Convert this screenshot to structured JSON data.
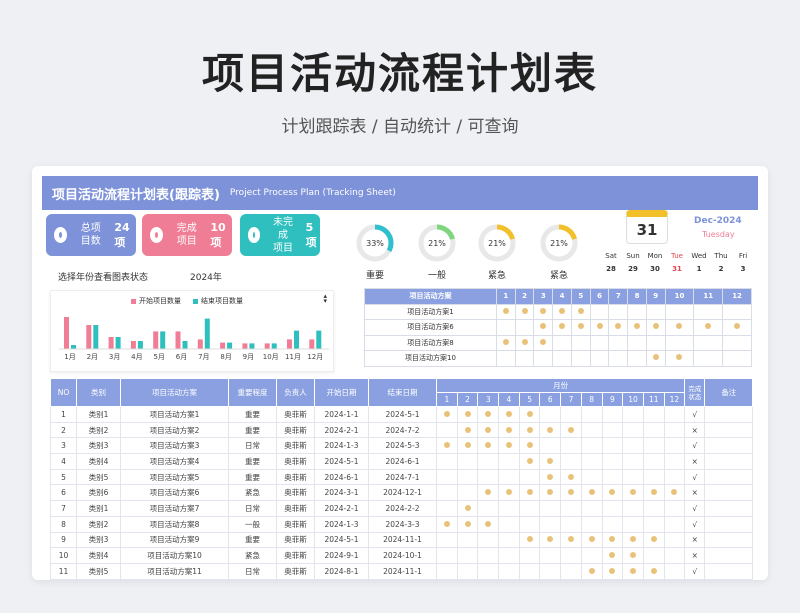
{
  "hero": {
    "title": "项目活动流程计划表",
    "subtitle": "计划跟踪表 / 自动统计 / 可查询"
  },
  "banner": {
    "title": "项目活动流程计划表(跟踪表)",
    "subtitle_en": "Project Process Plan (Tracking Sheet)"
  },
  "cards": [
    {
      "label": "总项\n目数",
      "value": "24项",
      "color": "#7d92d9"
    },
    {
      "label": "完成\n项目",
      "value": "10项",
      "color": "#f07d96"
    },
    {
      "label": "未完成\n项目",
      "value": "5项",
      "color": "#2fbfbf"
    }
  ],
  "select": {
    "label": "选择年份查看图表状态",
    "year": "2024年"
  },
  "donuts": [
    {
      "label": "重要",
      "pct": "33%",
      "value": 0.33,
      "color": "#2fbfcf"
    },
    {
      "label": "一般",
      "pct": "21%",
      "value": 0.21,
      "color": "#7fd67f"
    },
    {
      "label": "紧急",
      "pct": "21%",
      "value": 0.21,
      "color": "#f2c028"
    },
    {
      "label": "紧急",
      "pct": "21%",
      "value": 0.21,
      "color": "#f2c028"
    }
  ],
  "calendar": {
    "day": "31",
    "month": "Dec-2024",
    "weekday": "Tuesday",
    "days": [
      "Sat",
      "Sun",
      "Mon",
      "Tue",
      "Wed",
      "Thu",
      "Fri"
    ],
    "dates": [
      "28",
      "29",
      "30",
      "31",
      "1",
      "2",
      "3"
    ]
  },
  "chart_data": {
    "type": "bar",
    "categories": [
      "1月",
      "2月",
      "3月",
      "4月",
      "5月",
      "6月",
      "7月",
      "8月",
      "9月",
      "10月",
      "11月",
      "12月"
    ],
    "series": [
      {
        "name": "开始项目数量",
        "color": "#f07d96",
        "values": [
          4,
          3,
          1.5,
          1,
          2.2,
          2.2,
          1.2,
          0.8,
          0.7,
          0.7,
          1.2,
          1.2
        ]
      },
      {
        "name": "结束项目数量",
        "color": "#2fbfbf",
        "values": [
          0.5,
          3,
          1.5,
          1,
          2.2,
          1,
          3.8,
          0.8,
          0.7,
          0.7,
          2.3,
          2.3
        ]
      }
    ]
  },
  "mini": {
    "header": "项目活动方案",
    "months": [
      "1",
      "2",
      "3",
      "4",
      "5",
      "6",
      "7",
      "8",
      "9",
      "10",
      "11",
      "12"
    ],
    "rows": [
      {
        "name": "项目活动方案1",
        "m": [
          1,
          2,
          3,
          4,
          5
        ]
      },
      {
        "name": "项目活动方案6",
        "m": [
          3,
          4,
          5,
          6,
          7,
          8,
          9,
          10,
          11,
          12
        ]
      },
      {
        "name": "项目活动方案8",
        "m": [
          1,
          2,
          3
        ]
      },
      {
        "name": "项目活动方案10",
        "m": [
          9,
          10
        ]
      }
    ]
  },
  "table": {
    "headers": {
      "no": "NO",
      "cat": "类别",
      "plan": "项目活动方案",
      "level": "重要程度",
      "owner": "负责人",
      "start": "开始日期",
      "end": "结束日期",
      "months": "月份",
      "status": "完成\n状态",
      "note": "备注"
    },
    "months": [
      "1",
      "2",
      "3",
      "4",
      "5",
      "6",
      "7",
      "8",
      "9",
      "10",
      "11",
      "12"
    ],
    "rows": [
      {
        "no": "1",
        "cat": "类别1",
        "plan": "项目活动方案1",
        "level": "重要",
        "owner": "奥菲斯",
        "start": "2024-1-1",
        "end": "2024-5-1",
        "m": [
          1,
          2,
          3,
          4,
          5
        ],
        "status": "√"
      },
      {
        "no": "2",
        "cat": "类别2",
        "plan": "项目活动方案2",
        "level": "重要",
        "owner": "奥菲斯",
        "start": "2024-2-1",
        "end": "2024-7-2",
        "m": [
          2,
          3,
          4,
          5,
          6,
          7
        ],
        "status": "×"
      },
      {
        "no": "3",
        "cat": "类别3",
        "plan": "项目活动方案3",
        "level": "日常",
        "owner": "奥菲斯",
        "start": "2024-1-3",
        "end": "2024-5-3",
        "m": [
          1,
          2,
          3,
          4,
          5
        ],
        "status": "√"
      },
      {
        "no": "4",
        "cat": "类别4",
        "plan": "项目活动方案4",
        "level": "重要",
        "owner": "奥菲斯",
        "start": "2024-5-1",
        "end": "2024-6-1",
        "m": [
          5,
          6
        ],
        "status": "×"
      },
      {
        "no": "5",
        "cat": "类别5",
        "plan": "项目活动方案5",
        "level": "重要",
        "owner": "奥菲斯",
        "start": "2024-6-1",
        "end": "2024-7-1",
        "m": [
          6,
          7
        ],
        "status": "√"
      },
      {
        "no": "6",
        "cat": "类别6",
        "plan": "项目活动方案6",
        "level": "紧急",
        "owner": "奥菲斯",
        "start": "2024-3-1",
        "end": "2024-12-1",
        "m": [
          3,
          4,
          5,
          6,
          7,
          8,
          9,
          10,
          11,
          12
        ],
        "status": "×"
      },
      {
        "no": "7",
        "cat": "类别1",
        "plan": "项目活动方案7",
        "level": "日常",
        "owner": "奥菲斯",
        "start": "2024-2-1",
        "end": "2024-2-2",
        "m": [
          2
        ],
        "status": "√"
      },
      {
        "no": "8",
        "cat": "类别2",
        "plan": "项目活动方案8",
        "level": "一般",
        "owner": "奥菲斯",
        "start": "2024-1-3",
        "end": "2024-3-3",
        "m": [
          1,
          2,
          3
        ],
        "status": "√"
      },
      {
        "no": "9",
        "cat": "类别3",
        "plan": "项目活动方案9",
        "level": "重要",
        "owner": "奥菲斯",
        "start": "2024-5-1",
        "end": "2024-11-1",
        "m": [
          5,
          6,
          7,
          8,
          9,
          10,
          11
        ],
        "status": "×"
      },
      {
        "no": "10",
        "cat": "类别4",
        "plan": "项目活动方案10",
        "level": "紧急",
        "owner": "奥菲斯",
        "start": "2024-9-1",
        "end": "2024-10-1",
        "m": [
          9,
          10
        ],
        "status": "×"
      },
      {
        "no": "11",
        "cat": "类别5",
        "plan": "项目活动方案11",
        "level": "日常",
        "owner": "奥菲斯",
        "start": "2024-8-1",
        "end": "2024-11-1",
        "m": [
          8,
          9,
          10,
          11
        ],
        "status": "√"
      }
    ]
  }
}
